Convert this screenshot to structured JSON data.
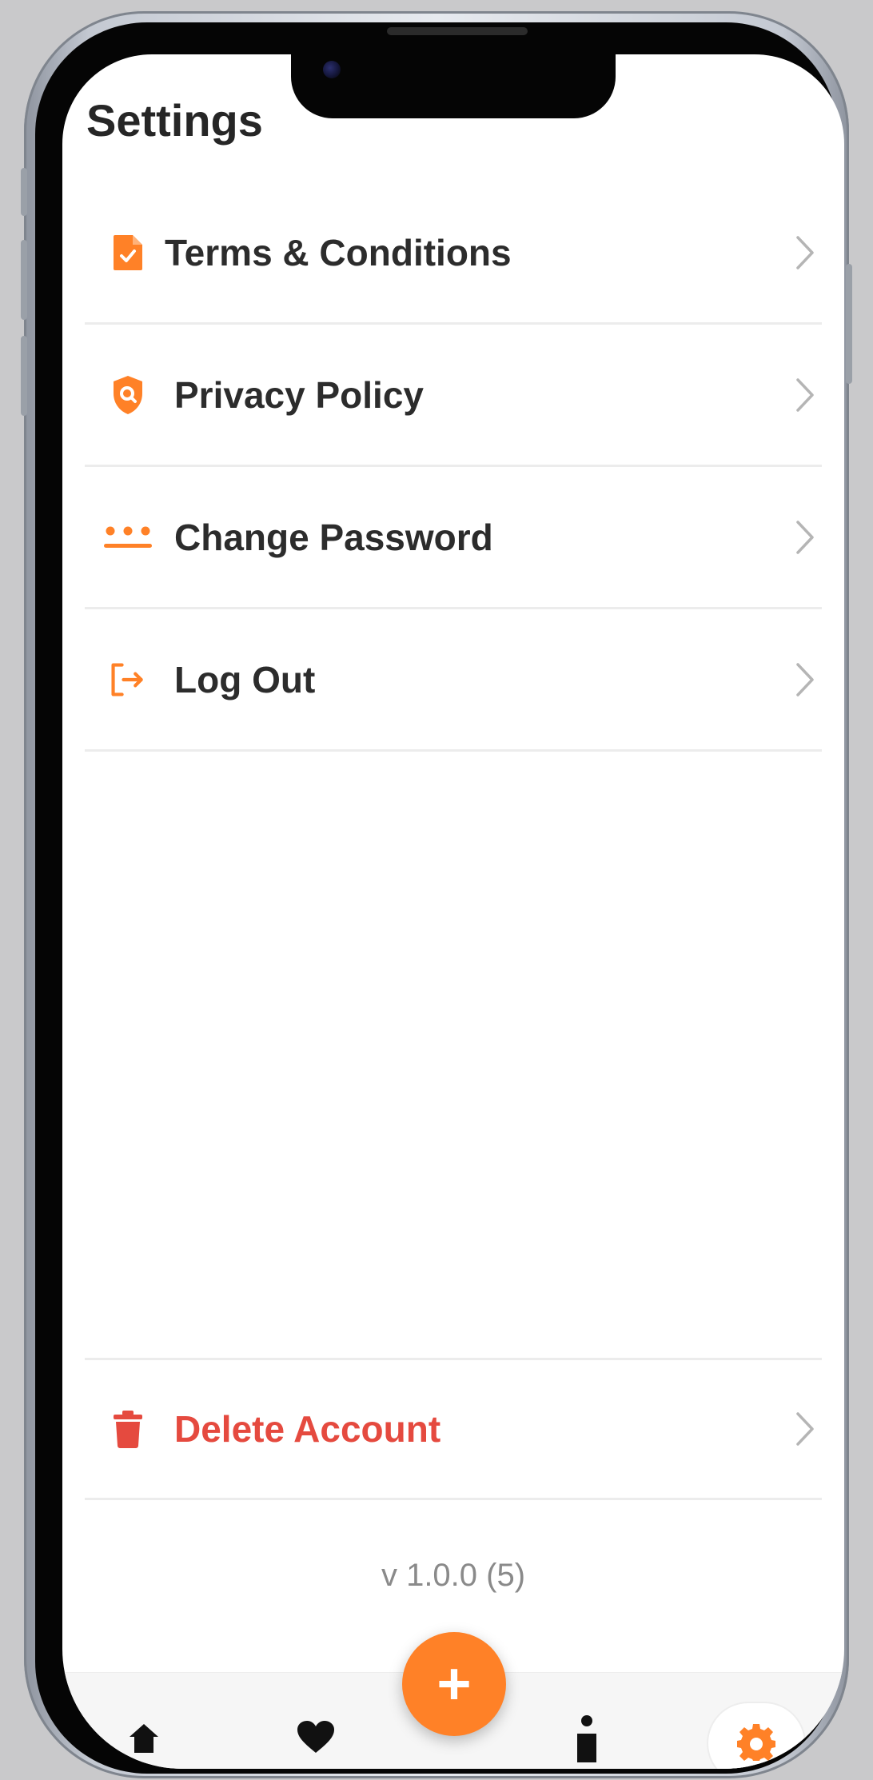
{
  "page_title": "Settings",
  "menu": [
    {
      "label": "Terms & Conditions",
      "icon": "document-check-icon"
    },
    {
      "label": "Privacy Policy",
      "icon": "shield-search-icon"
    },
    {
      "label": "Change Password",
      "icon": "password-dots-icon"
    },
    {
      "label": "Log Out",
      "icon": "logout-icon"
    }
  ],
  "danger_item": {
    "label": "Delete Account",
    "icon": "trash-icon"
  },
  "version": "v 1.0.0 (5)",
  "tabbar": {
    "fab_icon": "plus-icon",
    "tabs": [
      "home-icon",
      "heart-icon",
      "person-icon",
      "gear-icon"
    ],
    "active_tab": "gear-icon"
  },
  "colors": {
    "accent": "#ff8127",
    "danger": "#e54a3f",
    "text": "#2c2c2c",
    "divider": "#ececec"
  }
}
